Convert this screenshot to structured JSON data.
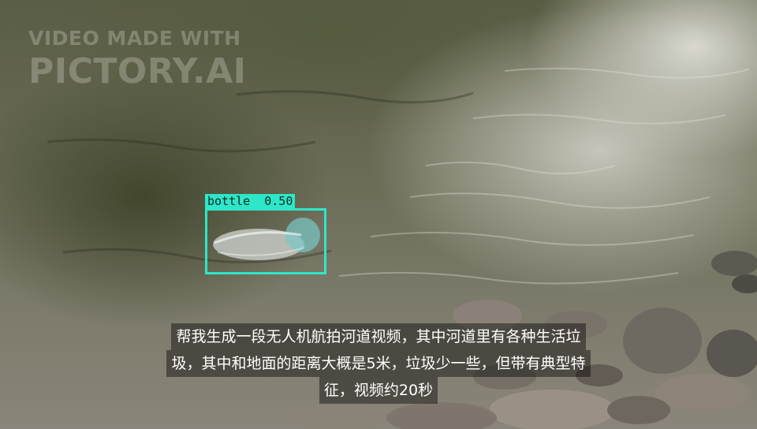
{
  "watermark": {
    "line1": "VIDEO MADE WITH",
    "line2": "PICTORY.AI"
  },
  "detection": {
    "label": "bottle  0.50",
    "color": "#2ee6c8"
  },
  "caption": {
    "lines": [
      "帮我生成一段无人机航拍河道视频，其中河道里有各种生活垃",
      "圾，其中和地面的距离大概是5米，垃圾少一些，但带有典型特",
      "征，视频约20秒"
    ]
  }
}
